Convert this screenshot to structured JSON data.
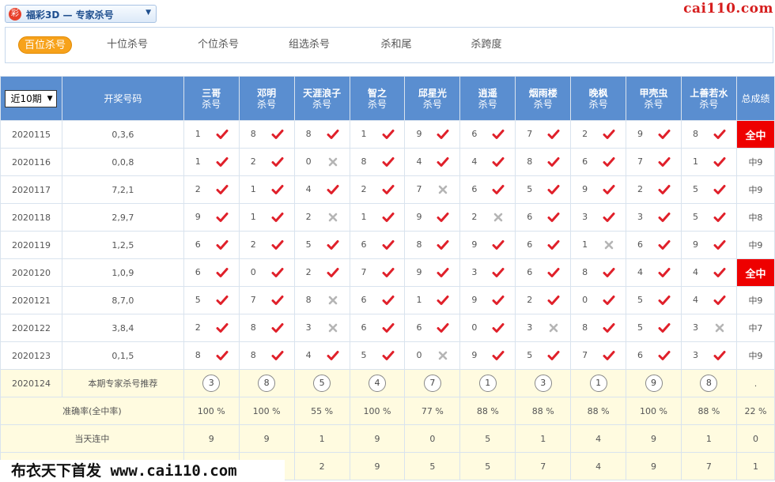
{
  "app": {
    "logo_glyph": "彩",
    "title": "福彩3D — 专家杀号",
    "caret": "▼"
  },
  "brand": {
    "url": "cai110.com"
  },
  "tabs": [
    {
      "label": "百位杀号",
      "active": true
    },
    {
      "label": "十位杀号",
      "active": false
    },
    {
      "label": "个位杀号",
      "active": false
    },
    {
      "label": "组选杀号",
      "active": false
    },
    {
      "label": "杀和尾",
      "active": false
    },
    {
      "label": "杀跨度",
      "active": false
    }
  ],
  "table": {
    "period_select": "近10期",
    "col_draw": "开奖号码",
    "col_total": "总成绩",
    "sub_label": "杀号",
    "experts": [
      "三哥",
      "邓明",
      "天涯浪子",
      "智之",
      "邱星光",
      "逍遥",
      "烟雨楼",
      "晚枫",
      "甲壳虫",
      "上善若水"
    ],
    "rows": [
      {
        "issue": "2020115",
        "draw": "0,3,6",
        "kills": [
          "1",
          "8",
          "8",
          "1",
          "9",
          "6",
          "7",
          "2",
          "9",
          "8"
        ],
        "hits": [
          true,
          true,
          true,
          true,
          true,
          true,
          true,
          true,
          true,
          true
        ],
        "total": "全中",
        "full": true
      },
      {
        "issue": "2020116",
        "draw": "0,0,8",
        "kills": [
          "1",
          "2",
          "0",
          "8",
          "4",
          "4",
          "8",
          "6",
          "7",
          "1"
        ],
        "hits": [
          true,
          true,
          false,
          true,
          true,
          true,
          true,
          true,
          true,
          true
        ],
        "total": "中9",
        "full": false
      },
      {
        "issue": "2020117",
        "draw": "7,2,1",
        "kills": [
          "2",
          "1",
          "4",
          "2",
          "7",
          "6",
          "5",
          "9",
          "2",
          "5"
        ],
        "hits": [
          true,
          true,
          true,
          true,
          false,
          true,
          true,
          true,
          true,
          true
        ],
        "total": "中9",
        "full": false
      },
      {
        "issue": "2020118",
        "draw": "2,9,7",
        "kills": [
          "9",
          "1",
          "2",
          "1",
          "9",
          "2",
          "6",
          "3",
          "3",
          "5"
        ],
        "hits": [
          true,
          true,
          false,
          true,
          true,
          false,
          true,
          true,
          true,
          true
        ],
        "total": "中8",
        "full": false
      },
      {
        "issue": "2020119",
        "draw": "1,2,5",
        "kills": [
          "6",
          "2",
          "5",
          "6",
          "8",
          "9",
          "6",
          "1",
          "6",
          "9"
        ],
        "hits": [
          true,
          true,
          true,
          true,
          true,
          true,
          true,
          false,
          true,
          true
        ],
        "total": "中9",
        "full": false
      },
      {
        "issue": "2020120",
        "draw": "1,0,9",
        "kills": [
          "6",
          "0",
          "2",
          "7",
          "9",
          "3",
          "6",
          "8",
          "4",
          "4"
        ],
        "hits": [
          true,
          true,
          true,
          true,
          true,
          true,
          true,
          true,
          true,
          true
        ],
        "total": "全中",
        "full": true
      },
      {
        "issue": "2020121",
        "draw": "8,7,0",
        "kills": [
          "5",
          "7",
          "8",
          "6",
          "1",
          "9",
          "2",
          "0",
          "5",
          "4"
        ],
        "hits": [
          true,
          true,
          false,
          true,
          true,
          true,
          true,
          true,
          true,
          true
        ],
        "total": "中9",
        "full": false
      },
      {
        "issue": "2020122",
        "draw": "3,8,4",
        "kills": [
          "2",
          "8",
          "3",
          "6",
          "6",
          "0",
          "3",
          "8",
          "5",
          "3"
        ],
        "hits": [
          true,
          true,
          false,
          true,
          true,
          true,
          false,
          true,
          true,
          false
        ],
        "total": "中7",
        "full": false
      },
      {
        "issue": "2020123",
        "draw": "0,1,5",
        "kills": [
          "8",
          "8",
          "4",
          "5",
          "0",
          "9",
          "5",
          "7",
          "6",
          "3"
        ],
        "hits": [
          true,
          true,
          true,
          true,
          false,
          true,
          true,
          true,
          true,
          true
        ],
        "total": "中9",
        "full": false
      }
    ],
    "recommend": {
      "issue": "2020124",
      "label": "本期专家杀号推荐",
      "values": [
        "3",
        "8",
        "5",
        "4",
        "7",
        "1",
        "3",
        "1",
        "9",
        "8"
      ],
      "total": "."
    },
    "accuracy": {
      "label": "准确率(全中率)",
      "values": [
        "100 %",
        "100 %",
        "55 %",
        "100 %",
        "77 %",
        "88 %",
        "88 %",
        "88 %",
        "100 %",
        "88 %"
      ],
      "total": "22 %"
    },
    "streak": {
      "label": "当天连中",
      "values": [
        "9",
        "9",
        "1",
        "9",
        "0",
        "5",
        "1",
        "4",
        "9",
        "1"
      ],
      "total": "0"
    },
    "last_row": {
      "values": [
        "",
        "",
        "2",
        "9",
        "5",
        "5",
        "7",
        "4",
        "9",
        "7"
      ],
      "total": "1"
    }
  },
  "watermark": "布衣天下首发 www.cai110.com",
  "colors": {
    "header_blue": "#5a8ed0",
    "hit_red": "#e0202a",
    "miss_gray": "#b5b5b5",
    "full_red": "#ee0000",
    "tab_orange": "#f7a21b",
    "summary_bg": "#fffbe0"
  }
}
